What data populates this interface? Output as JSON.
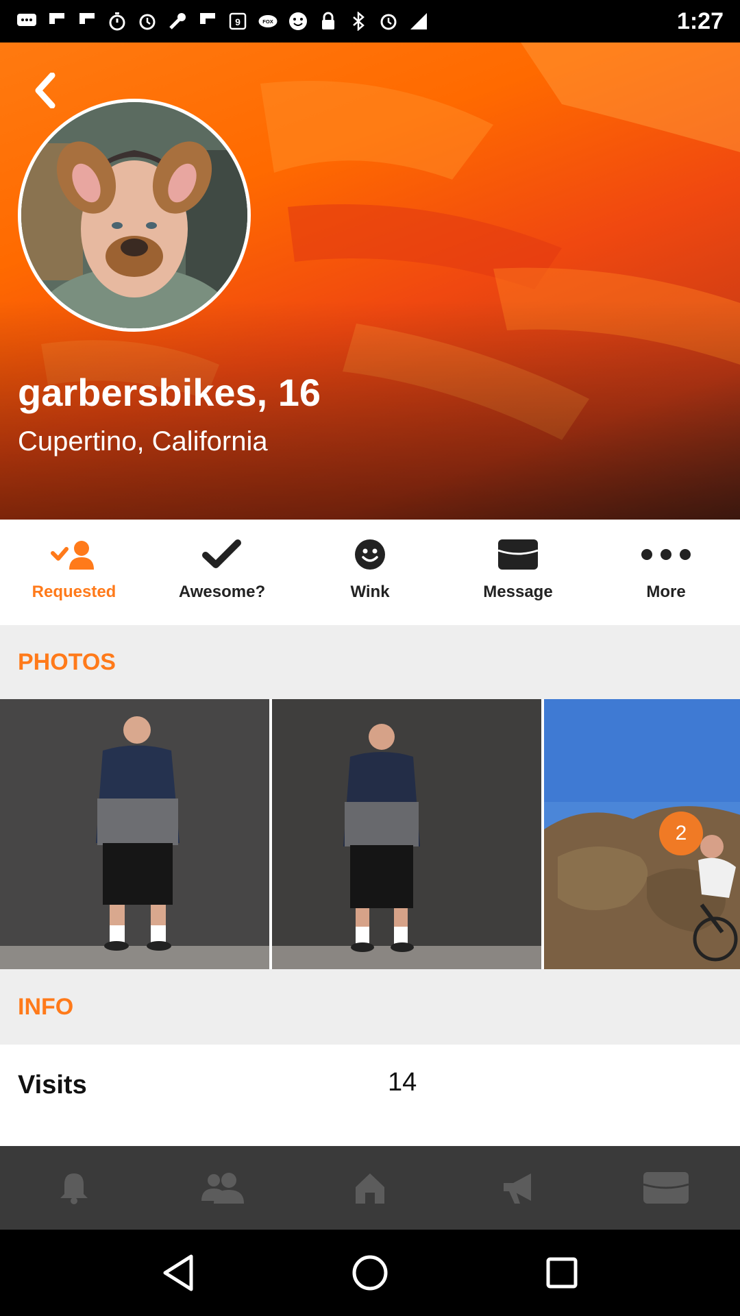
{
  "status_bar": {
    "time": "1:27",
    "icons": [
      "chat-icon",
      "flipboard-icon",
      "flipboard-icon",
      "stopwatch-icon",
      "alarm-icon",
      "wrench-icon",
      "flipboard-icon",
      "mail-icon",
      "fox-sports-icon",
      "emoji-icon",
      "lock-icon",
      "bluetooth-icon",
      "alarm-icon",
      "signal-icon"
    ]
  },
  "profile": {
    "name": "garbersbikes, 16",
    "location": "Cupertino, California"
  },
  "actions": [
    {
      "label": "Requested",
      "icon": "requested-icon",
      "active": true
    },
    {
      "label": "Awesome?",
      "icon": "check-icon",
      "active": false
    },
    {
      "label": "Wink",
      "icon": "wink-icon",
      "active": false
    },
    {
      "label": "Message",
      "icon": "message-icon",
      "active": false
    },
    {
      "label": "More",
      "icon": "more-icon",
      "active": false
    }
  ],
  "photos": {
    "header": "PHOTOS",
    "more_count": "2"
  },
  "info": {
    "header": "INFO",
    "visits_label": "Visits",
    "visits_value": "14"
  },
  "bottom_nav": [
    "bell-icon",
    "people-icon",
    "home-icon",
    "megaphone-icon",
    "inbox-icon"
  ],
  "colors": {
    "accent": "#ff7a1a",
    "nav_bg": "#3a3a3a",
    "section_bg": "#eeeeee"
  }
}
